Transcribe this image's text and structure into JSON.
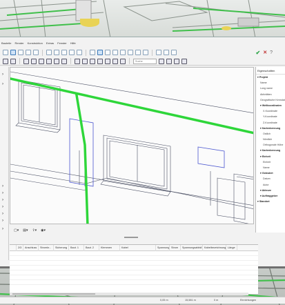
{
  "menu": [
    "Bauteile",
    "Render",
    "Konstruktion",
    "Extras",
    "Fenster",
    "Hilfe"
  ],
  "toolbar": {
    "search_placeholder": "Suche",
    "confirm_icon": "check-icon",
    "cancel_icon": "close-icon",
    "help_icon": "question-icon"
  },
  "properties": {
    "title": "Eigenschaften",
    "rows": [
      {
        "label": "Projekt",
        "level": 0,
        "bold": true
      },
      {
        "label": "Name",
        "level": 1
      },
      {
        "label": "Long name",
        "level": 1
      },
      {
        "label": "Aktivitäten",
        "level": 1
      },
      {
        "label": "Geografische Kenndaten",
        "level": 1
      },
      {
        "label": "Weltkoordinaten",
        "level": 1,
        "bold": true
      },
      {
        "label": "X-Koordinate",
        "level": 2
      },
      {
        "label": "Y-Koordinate",
        "level": 2
      },
      {
        "label": "Z-Koordinate",
        "level": 2
      },
      {
        "label": "Kartenkennung",
        "level": 1,
        "bold": true
      },
      {
        "label": "Ostlich",
        "level": 2
      },
      {
        "label": "Nördlich",
        "level": 2
      },
      {
        "label": "Orthogonale Höhe",
        "level": 2
      },
      {
        "label": "Kartenkennung",
        "level": 1,
        "bold": true
      },
      {
        "label": "Einheit",
        "level": 1,
        "bold": true
      },
      {
        "label": "Einheit",
        "level": 2
      },
      {
        "label": "Name",
        "level": 2
      },
      {
        "label": "Geändert",
        "level": 1,
        "bold": true
      },
      {
        "label": "Datum",
        "level": 2
      },
      {
        "label": "Autor",
        "level": 2
      },
      {
        "label": "Akteure",
        "level": 1,
        "bold": true
      },
      {
        "label": "Auftraggeber",
        "level": 1,
        "bold": true
      },
      {
        "label": "Standort",
        "level": 0,
        "bold": true
      }
    ]
  },
  "table": {
    "columns": [
      "",
      "2/3",
      "Anschluss",
      "Stromkr...",
      "Sicherung",
      "Baut. 1",
      "Baut. 2",
      "Klemmen",
      "Kabel",
      "Spannung",
      "Strom",
      "Spannungsabfall",
      "Kabelbezeichnung",
      "Länge"
    ]
  },
  "status": {
    "values": [
      "0,05 m",
      "15,581 m",
      "0 m",
      "Einrichtungen"
    ]
  },
  "colors": {
    "accent": "#1f62b4",
    "highlight_wire": "#2ed63a",
    "check": "#2fa54a"
  }
}
